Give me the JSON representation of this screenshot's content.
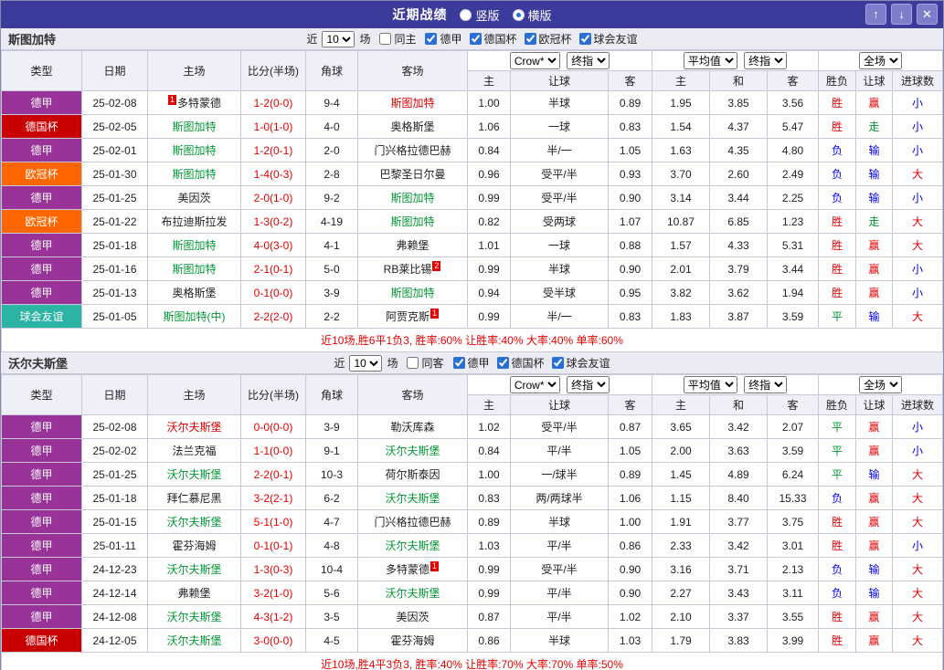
{
  "titlebar": {
    "title": "近期战绩",
    "radios": [
      {
        "label": "竖版",
        "selected": false
      },
      {
        "label": "横版",
        "selected": true
      }
    ],
    "buttons": {
      "up": "↑",
      "down": "↓",
      "close": "✕"
    }
  },
  "table_header": {
    "fixed_cols": [
      "类型",
      "日期",
      "主场",
      "比分(半场)",
      "角球",
      "客场"
    ],
    "group1": {
      "select_a": "Crow*",
      "select_b": "终指",
      "subcols": [
        "主",
        "让球",
        "客"
      ]
    },
    "group2": {
      "select_a": "平均值",
      "select_b": "终指",
      "subcols": [
        "主",
        "和",
        "客"
      ]
    },
    "group3": {
      "select_a": "全场",
      "subcols": [
        "胜负",
        "让球",
        "进球数"
      ]
    }
  },
  "colors": {
    "league": {
      "德甲": "#993399",
      "德国杯": "#c80000",
      "欧冠杯": "#ff6600",
      "球会友谊": "#2bb3a3"
    },
    "result": {
      "胜": "#e60000",
      "负": "#0000ee",
      "平": "#009933",
      "赢": "#e60000",
      "输": "#0000ee",
      "走": "#009933",
      "大": "#e60000",
      "小": "#0000ee"
    },
    "score": "#e60000",
    "team": "#009933",
    "team_recent": "#dd0000",
    "summary": "#e60000"
  },
  "sections": [
    {
      "team": "斯图加特",
      "filter": {
        "near": "近",
        "count": "10",
        "games": "场",
        "same": "同主",
        "same_checked": false,
        "leagues": [
          {
            "label": "德甲",
            "checked": true
          },
          {
            "label": "德国杯",
            "checked": true
          },
          {
            "label": "欧冠杯",
            "checked": true
          },
          {
            "label": "球会友谊",
            "checked": true
          }
        ]
      },
      "rows": [
        {
          "league": "德甲",
          "date": "25-02-08",
          "home": "多特蒙德",
          "home_rank": "1",
          "away": "斯图加特",
          "team_side": "away",
          "recent": true,
          "score": "1-2(0-0)",
          "corners": "9-4",
          "ah": [
            "1.00",
            "半球",
            "0.89"
          ],
          "eu": [
            "1.95",
            "3.85",
            "3.56"
          ],
          "res": [
            "胜",
            "赢",
            "小"
          ]
        },
        {
          "league": "德国杯",
          "date": "25-02-05",
          "home": "斯图加特",
          "away": "奥格斯堡",
          "team_side": "home",
          "score": "1-0(1-0)",
          "corners": "4-0",
          "ah": [
            "1.06",
            "一球",
            "0.83"
          ],
          "eu": [
            "1.54",
            "4.37",
            "5.47"
          ],
          "res": [
            "胜",
            "走",
            "小"
          ]
        },
        {
          "league": "德甲",
          "date": "25-02-01",
          "home": "斯图加特",
          "away": "门兴格拉德巴赫",
          "team_side": "home",
          "score": "1-2(0-1)",
          "corners": "2-0",
          "ah": [
            "0.84",
            "半/一",
            "1.05"
          ],
          "eu": [
            "1.63",
            "4.35",
            "4.80"
          ],
          "res": [
            "负",
            "输",
            "小"
          ]
        },
        {
          "league": "欧冠杯",
          "date": "25-01-30",
          "home": "斯图加特",
          "away": "巴黎圣日尔曼",
          "team_side": "home",
          "score": "1-4(0-3)",
          "corners": "2-8",
          "ah": [
            "0.96",
            "受平/半",
            "0.93"
          ],
          "eu": [
            "3.70",
            "2.60",
            "2.49"
          ],
          "res": [
            "负",
            "输",
            "大"
          ]
        },
        {
          "league": "德甲",
          "date": "25-01-25",
          "home": "美因茨",
          "away": "斯图加特",
          "team_side": "away",
          "score": "2-0(1-0)",
          "corners": "9-2",
          "ah": [
            "0.99",
            "受平/半",
            "0.90"
          ],
          "eu": [
            "3.14",
            "3.44",
            "2.25"
          ],
          "res": [
            "负",
            "输",
            "小"
          ]
        },
        {
          "league": "欧冠杯",
          "date": "25-01-22",
          "home": "布拉迪斯拉发",
          "away": "斯图加特",
          "team_side": "away",
          "score": "1-3(0-2)",
          "corners": "4-19",
          "ah": [
            "0.82",
            "受两球",
            "1.07"
          ],
          "eu": [
            "10.87",
            "6.85",
            "1.23"
          ],
          "res": [
            "胜",
            "走",
            "大"
          ]
        },
        {
          "league": "德甲",
          "date": "25-01-18",
          "home": "斯图加特",
          "away": "弗赖堡",
          "team_side": "home",
          "score": "4-0(3-0)",
          "corners": "4-1",
          "ah": [
            "1.01",
            "一球",
            "0.88"
          ],
          "eu": [
            "1.57",
            "4.33",
            "5.31"
          ],
          "res": [
            "胜",
            "赢",
            "大"
          ]
        },
        {
          "league": "德甲",
          "date": "25-01-16",
          "home": "斯图加特",
          "away": "RB莱比锡",
          "away_rank": "2",
          "team_side": "home",
          "score": "2-1(0-1)",
          "corners": "5-0",
          "ah": [
            "0.99",
            "半球",
            "0.90"
          ],
          "eu": [
            "2.01",
            "3.79",
            "3.44"
          ],
          "res": [
            "胜",
            "赢",
            "小"
          ]
        },
        {
          "league": "德甲",
          "date": "25-01-13",
          "home": "奥格斯堡",
          "away": "斯图加特",
          "team_side": "away",
          "score": "0-1(0-0)",
          "corners": "3-9",
          "ah": [
            "0.94",
            "受半球",
            "0.95"
          ],
          "eu": [
            "3.82",
            "3.62",
            "1.94"
          ],
          "res": [
            "胜",
            "赢",
            "小"
          ]
        },
        {
          "league": "球会友谊",
          "date": "25-01-05",
          "home": "斯图加特(中)",
          "away": "阿贾克斯",
          "away_rank": "1",
          "team_side": "home",
          "score": "2-2(2-0)",
          "corners": "2-2",
          "ah": [
            "0.99",
            "半/一",
            "0.83"
          ],
          "eu": [
            "1.83",
            "3.87",
            "3.59"
          ],
          "res": [
            "平",
            "输",
            "大"
          ]
        }
      ],
      "summary": "近10场,胜6平1负3, 胜率:60% 让胜率:40% 大率:40% 单率:60%"
    },
    {
      "team": "沃尔夫斯堡",
      "filter": {
        "near": "近",
        "count": "10",
        "games": "场",
        "same": "同客",
        "same_checked": false,
        "leagues": [
          {
            "label": "德甲",
            "checked": true
          },
          {
            "label": "德国杯",
            "checked": true
          },
          {
            "label": "球会友谊",
            "checked": true
          }
        ]
      },
      "rows": [
        {
          "league": "德甲",
          "date": "25-02-08",
          "home": "沃尔夫斯堡",
          "away": "勒沃库森",
          "team_side": "home",
          "recent": true,
          "score": "0-0(0-0)",
          "corners": "3-9",
          "ah": [
            "1.02",
            "受平/半",
            "0.87"
          ],
          "eu": [
            "3.65",
            "3.42",
            "2.07"
          ],
          "res": [
            "平",
            "赢",
            "小"
          ]
        },
        {
          "league": "德甲",
          "date": "25-02-02",
          "home": "法兰克福",
          "away": "沃尔夫斯堡",
          "team_side": "away",
          "score": "1-1(0-0)",
          "corners": "9-1",
          "ah": [
            "0.84",
            "平/半",
            "1.05"
          ],
          "eu": [
            "2.00",
            "3.63",
            "3.59"
          ],
          "res": [
            "平",
            "赢",
            "小"
          ]
        },
        {
          "league": "德甲",
          "date": "25-01-25",
          "home": "沃尔夫斯堡",
          "away": "荷尔斯泰因",
          "team_side": "home",
          "score": "2-2(0-1)",
          "corners": "10-3",
          "ah": [
            "1.00",
            "一/球半",
            "0.89"
          ],
          "eu": [
            "1.45",
            "4.89",
            "6.24"
          ],
          "res": [
            "平",
            "输",
            "大"
          ]
        },
        {
          "league": "德甲",
          "date": "25-01-18",
          "home": "拜仁慕尼黑",
          "away": "沃尔夫斯堡",
          "team_side": "away",
          "score": "3-2(2-1)",
          "corners": "6-2",
          "ah": [
            "0.83",
            "两/两球半",
            "1.06"
          ],
          "eu": [
            "1.15",
            "8.40",
            "15.33"
          ],
          "res": [
            "负",
            "赢",
            "大"
          ]
        },
        {
          "league": "德甲",
          "date": "25-01-15",
          "home": "沃尔夫斯堡",
          "away": "门兴格拉德巴赫",
          "team_side": "home",
          "score": "5-1(1-0)",
          "corners": "4-7",
          "ah": [
            "0.89",
            "半球",
            "1.00"
          ],
          "eu": [
            "1.91",
            "3.77",
            "3.75"
          ],
          "res": [
            "胜",
            "赢",
            "大"
          ]
        },
        {
          "league": "德甲",
          "date": "25-01-11",
          "home": "霍芬海姆",
          "away": "沃尔夫斯堡",
          "team_side": "away",
          "score": "0-1(0-1)",
          "corners": "4-8",
          "ah": [
            "1.03",
            "平/半",
            "0.86"
          ],
          "eu": [
            "2.33",
            "3.42",
            "3.01"
          ],
          "res": [
            "胜",
            "赢",
            "小"
          ]
        },
        {
          "league": "德甲",
          "date": "24-12-23",
          "home": "沃尔夫斯堡",
          "away": "多特蒙德",
          "away_rank": "1",
          "team_side": "home",
          "score": "1-3(0-3)",
          "corners": "10-4",
          "ah": [
            "0.99",
            "受平/半",
            "0.90"
          ],
          "eu": [
            "3.16",
            "3.71",
            "2.13"
          ],
          "res": [
            "负",
            "输",
            "大"
          ]
        },
        {
          "league": "德甲",
          "date": "24-12-14",
          "home": "弗赖堡",
          "away": "沃尔夫斯堡",
          "team_side": "away",
          "score": "3-2(1-0)",
          "corners": "5-6",
          "ah": [
            "0.99",
            "平/半",
            "0.90"
          ],
          "eu": [
            "2.27",
            "3.43",
            "3.11"
          ],
          "res": [
            "负",
            "输",
            "大"
          ]
        },
        {
          "league": "德甲",
          "date": "24-12-08",
          "home": "沃尔夫斯堡",
          "away": "美因茨",
          "team_side": "home",
          "score": "4-3(1-2)",
          "corners": "3-5",
          "ah": [
            "0.87",
            "平/半",
            "1.02"
          ],
          "eu": [
            "2.10",
            "3.37",
            "3.55"
          ],
          "res": [
            "胜",
            "赢",
            "大"
          ]
        },
        {
          "league": "德国杯",
          "date": "24-12-05",
          "home": "沃尔夫斯堡",
          "away": "霍芬海姆",
          "team_side": "home",
          "score": "3-0(0-0)",
          "corners": "4-5",
          "ah": [
            "0.86",
            "半球",
            "1.03"
          ],
          "eu": [
            "1.79",
            "3.83",
            "3.99"
          ],
          "res": [
            "胜",
            "赢",
            "大"
          ]
        }
      ],
      "summary": "近10场,胜4平3负3, 胜率:40% 让胜率:70% 大率:70% 单率:50%"
    }
  ]
}
